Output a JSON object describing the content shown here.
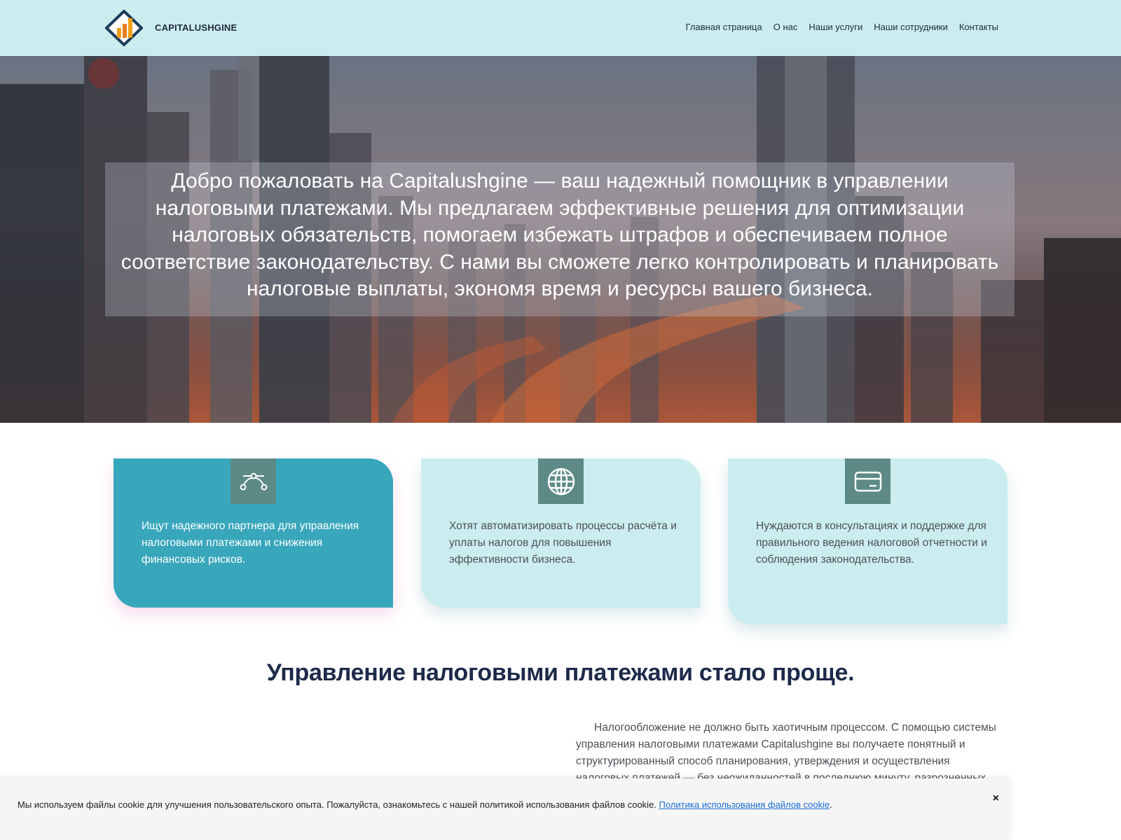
{
  "header": {
    "brand": "CAPITALUSHGINE",
    "nav": [
      "Главная страница",
      "О нас",
      "Наши услуги",
      "Наши сотрудники",
      "Контакты"
    ]
  },
  "hero": {
    "text": "Добро пожаловать на Capitalushgine — ваш надежный помощник в управлении налоговыми платежами. Мы предлагаем эффективные решения для оптимизации налоговых обязательств, помогаем избежать штрафов и обеспечиваем полное соответствие законодательству. С нами вы сможете легко контролировать и планировать налоговые выплаты, экономя время и ресурсы вашего бизнеса."
  },
  "cards": [
    {
      "icon": "bezier-curve-icon",
      "text": "Ищут надежного партнера для управления налоговыми платежами и снижения финансовых рисков."
    },
    {
      "icon": "globe-icon",
      "text": "Хотят автоматизировать процессы расчёта и уплаты налогов для повышения эффективности бизнеса."
    },
    {
      "icon": "credit-card-icon",
      "text": "Нуждаются в консультациях и поддержке для правильного ведения налоговой отчетности и соблюдения законодательства."
    }
  ],
  "section": {
    "title": "Управление налоговыми платежами стало проще.",
    "text": "Налогообложение не должно быть хаотичным процессом. С помощью системы управления налоговыми платежами Capitalushgine вы получаете понятный и структурированный способ планирования, утверждения и осуществления налоговых платежей — без неожиданностей в последнюю минуту, разрозненных таблиц или"
  },
  "cookie": {
    "text": "Мы используем файлы cookie для улучшения пользовательского опыта. Пожалуйста, ознакомьтесь с нашей политикой использования файлов cookie.",
    "link": "Политика использования файлов cookie",
    "suffix": ".",
    "close": "×"
  },
  "colors": {
    "header_bg": "#ccedef",
    "card_primary": "#38a6bb",
    "card_light": "#ccedef",
    "icon_bg": "#5d8a86",
    "title": "#1e2a4a"
  }
}
